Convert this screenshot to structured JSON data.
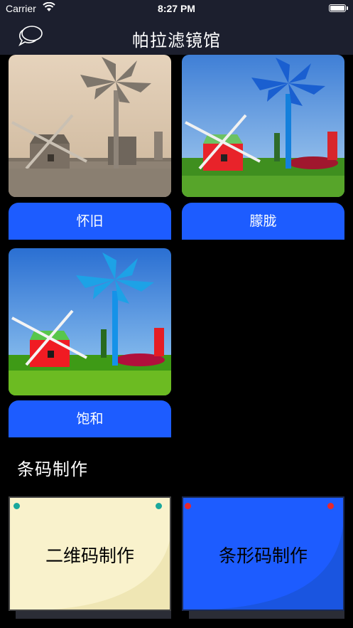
{
  "status_bar": {
    "carrier": "Carrier",
    "time": "8:27 PM"
  },
  "nav": {
    "title": "帕拉滤镜馆",
    "left_icon": "chat-bubbles-icon"
  },
  "filters": [
    {
      "label": "怀旧",
      "style": "sepia"
    },
    {
      "label": "朦胧",
      "style": "hazy"
    },
    {
      "label": "饱和",
      "style": "saturated"
    }
  ],
  "section": {
    "title": "条码制作"
  },
  "barcode_tools": [
    {
      "label": "二维码制作",
      "paper_color": "#f9f2cc",
      "pin_color": "#1aa89c"
    },
    {
      "label": "条形码制作",
      "paper_color": "#1d5cff",
      "pin_color": "#e8282c"
    }
  ],
  "colors": {
    "accent": "#1d5cff",
    "nav_bg": "#1c1f2e",
    "background": "#000000"
  }
}
